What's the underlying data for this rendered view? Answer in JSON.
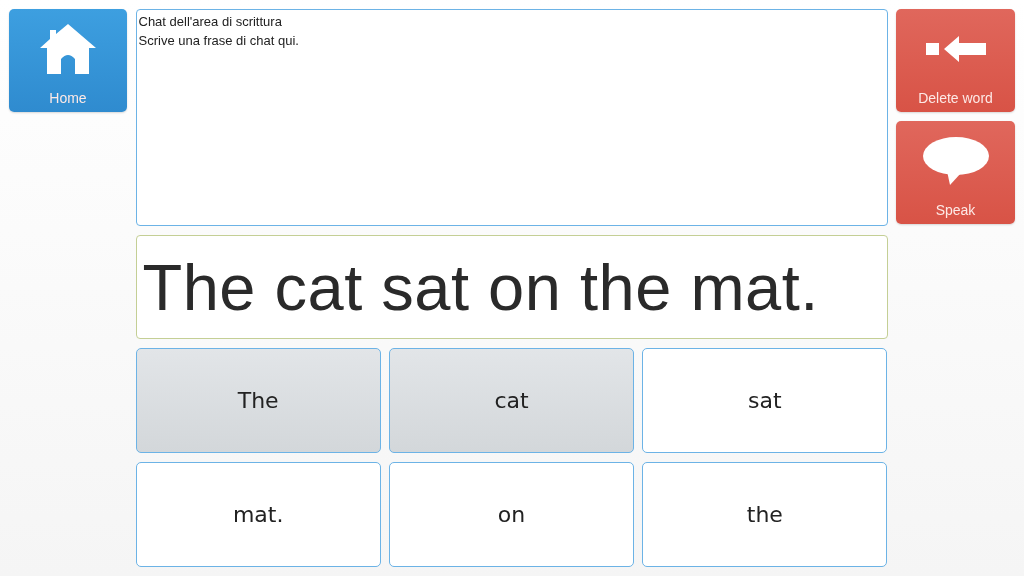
{
  "left_buttons": [
    {
      "kind": "home",
      "label": "Home"
    }
  ],
  "chat_area": {
    "lines": [
      "Chat dell'area di scrittura",
      "Scrive una frase di chat qui."
    ]
  },
  "sentence": "The cat sat on the mat.",
  "words": [
    {
      "label": "The",
      "selected": true
    },
    {
      "label": "cat",
      "selected": true
    },
    {
      "label": "sat",
      "selected": false
    },
    {
      "label": "mat.",
      "selected": false
    },
    {
      "label": "on",
      "selected": false
    },
    {
      "label": "the",
      "selected": false
    }
  ],
  "right_buttons": [
    {
      "kind": "delete",
      "label": "Delete word"
    },
    {
      "kind": "speak",
      "label": "Speak"
    }
  ]
}
